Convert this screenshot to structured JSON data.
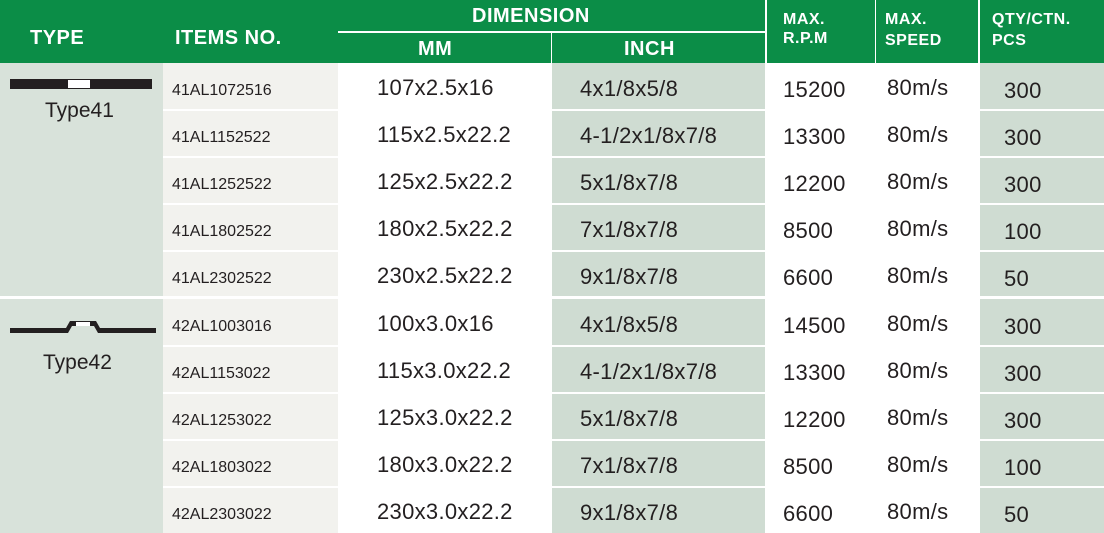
{
  "header": {
    "type": "TYPE",
    "items_no": "ITEMS NO.",
    "dimension": "DIMENSION",
    "mm": "MM",
    "inch": "INCH",
    "rpm_line1": "MAX.",
    "rpm_line2": "R.P.M",
    "speed_line1": "MAX.",
    "speed_line2": "SPEED",
    "qty_line1": "QTY/CTN.",
    "qty_line2": "PCS"
  },
  "colors": {
    "header_green": "#0b8d47",
    "type_column": "#d8e2da",
    "item_column": "#f2f2ee",
    "inch_column": "#cfdcd2",
    "qty_column": "#cfdcd2"
  },
  "groups": [
    {
      "type_label": "Type41",
      "icon": "type41-flat-disc-icon",
      "rows": [
        {
          "item": "41AL1072516",
          "mm": "107x2.5x16",
          "inch": "4x1/8x5/8",
          "rpm": "15200",
          "speed": "80m/s",
          "qty": "300"
        },
        {
          "item": "41AL1152522",
          "mm": "115x2.5x22.2",
          "inch": "4-1/2x1/8x7/8",
          "rpm": "13300",
          "speed": "80m/s",
          "qty": "300"
        },
        {
          "item": "41AL1252522",
          "mm": "125x2.5x22.2",
          "inch": "5x1/8x7/8",
          "rpm": "12200",
          "speed": "80m/s",
          "qty": "300"
        },
        {
          "item": "41AL1802522",
          "mm": "180x2.5x22.2",
          "inch": "7x1/8x7/8",
          "rpm": "8500",
          "speed": "80m/s",
          "qty": "100"
        },
        {
          "item": "41AL2302522",
          "mm": "230x2.5x22.2",
          "inch": "9x1/8x7/8",
          "rpm": "6600",
          "speed": "80m/s",
          "qty": "50"
        }
      ]
    },
    {
      "type_label": "Type42",
      "icon": "type42-depressed-center-disc-icon",
      "rows": [
        {
          "item": "42AL1003016",
          "mm": "100x3.0x16",
          "inch": "4x1/8x5/8",
          "rpm": "14500",
          "speed": "80m/s",
          "qty": "300"
        },
        {
          "item": "42AL1153022",
          "mm": "115x3.0x22.2",
          "inch": "4-1/2x1/8x7/8",
          "rpm": "13300",
          "speed": "80m/s",
          "qty": "300"
        },
        {
          "item": "42AL1253022",
          "mm": "125x3.0x22.2",
          "inch": "5x1/8x7/8",
          "rpm": "12200",
          "speed": "80m/s",
          "qty": "300"
        },
        {
          "item": "42AL1803022",
          "mm": "180x3.0x22.2",
          "inch": "7x1/8x7/8",
          "rpm": "8500",
          "speed": "80m/s",
          "qty": "100"
        },
        {
          "item": "42AL2303022",
          "mm": "230x3.0x22.2",
          "inch": "9x1/8x7/8",
          "rpm": "6600",
          "speed": "80m/s",
          "qty": "50"
        }
      ]
    }
  ]
}
